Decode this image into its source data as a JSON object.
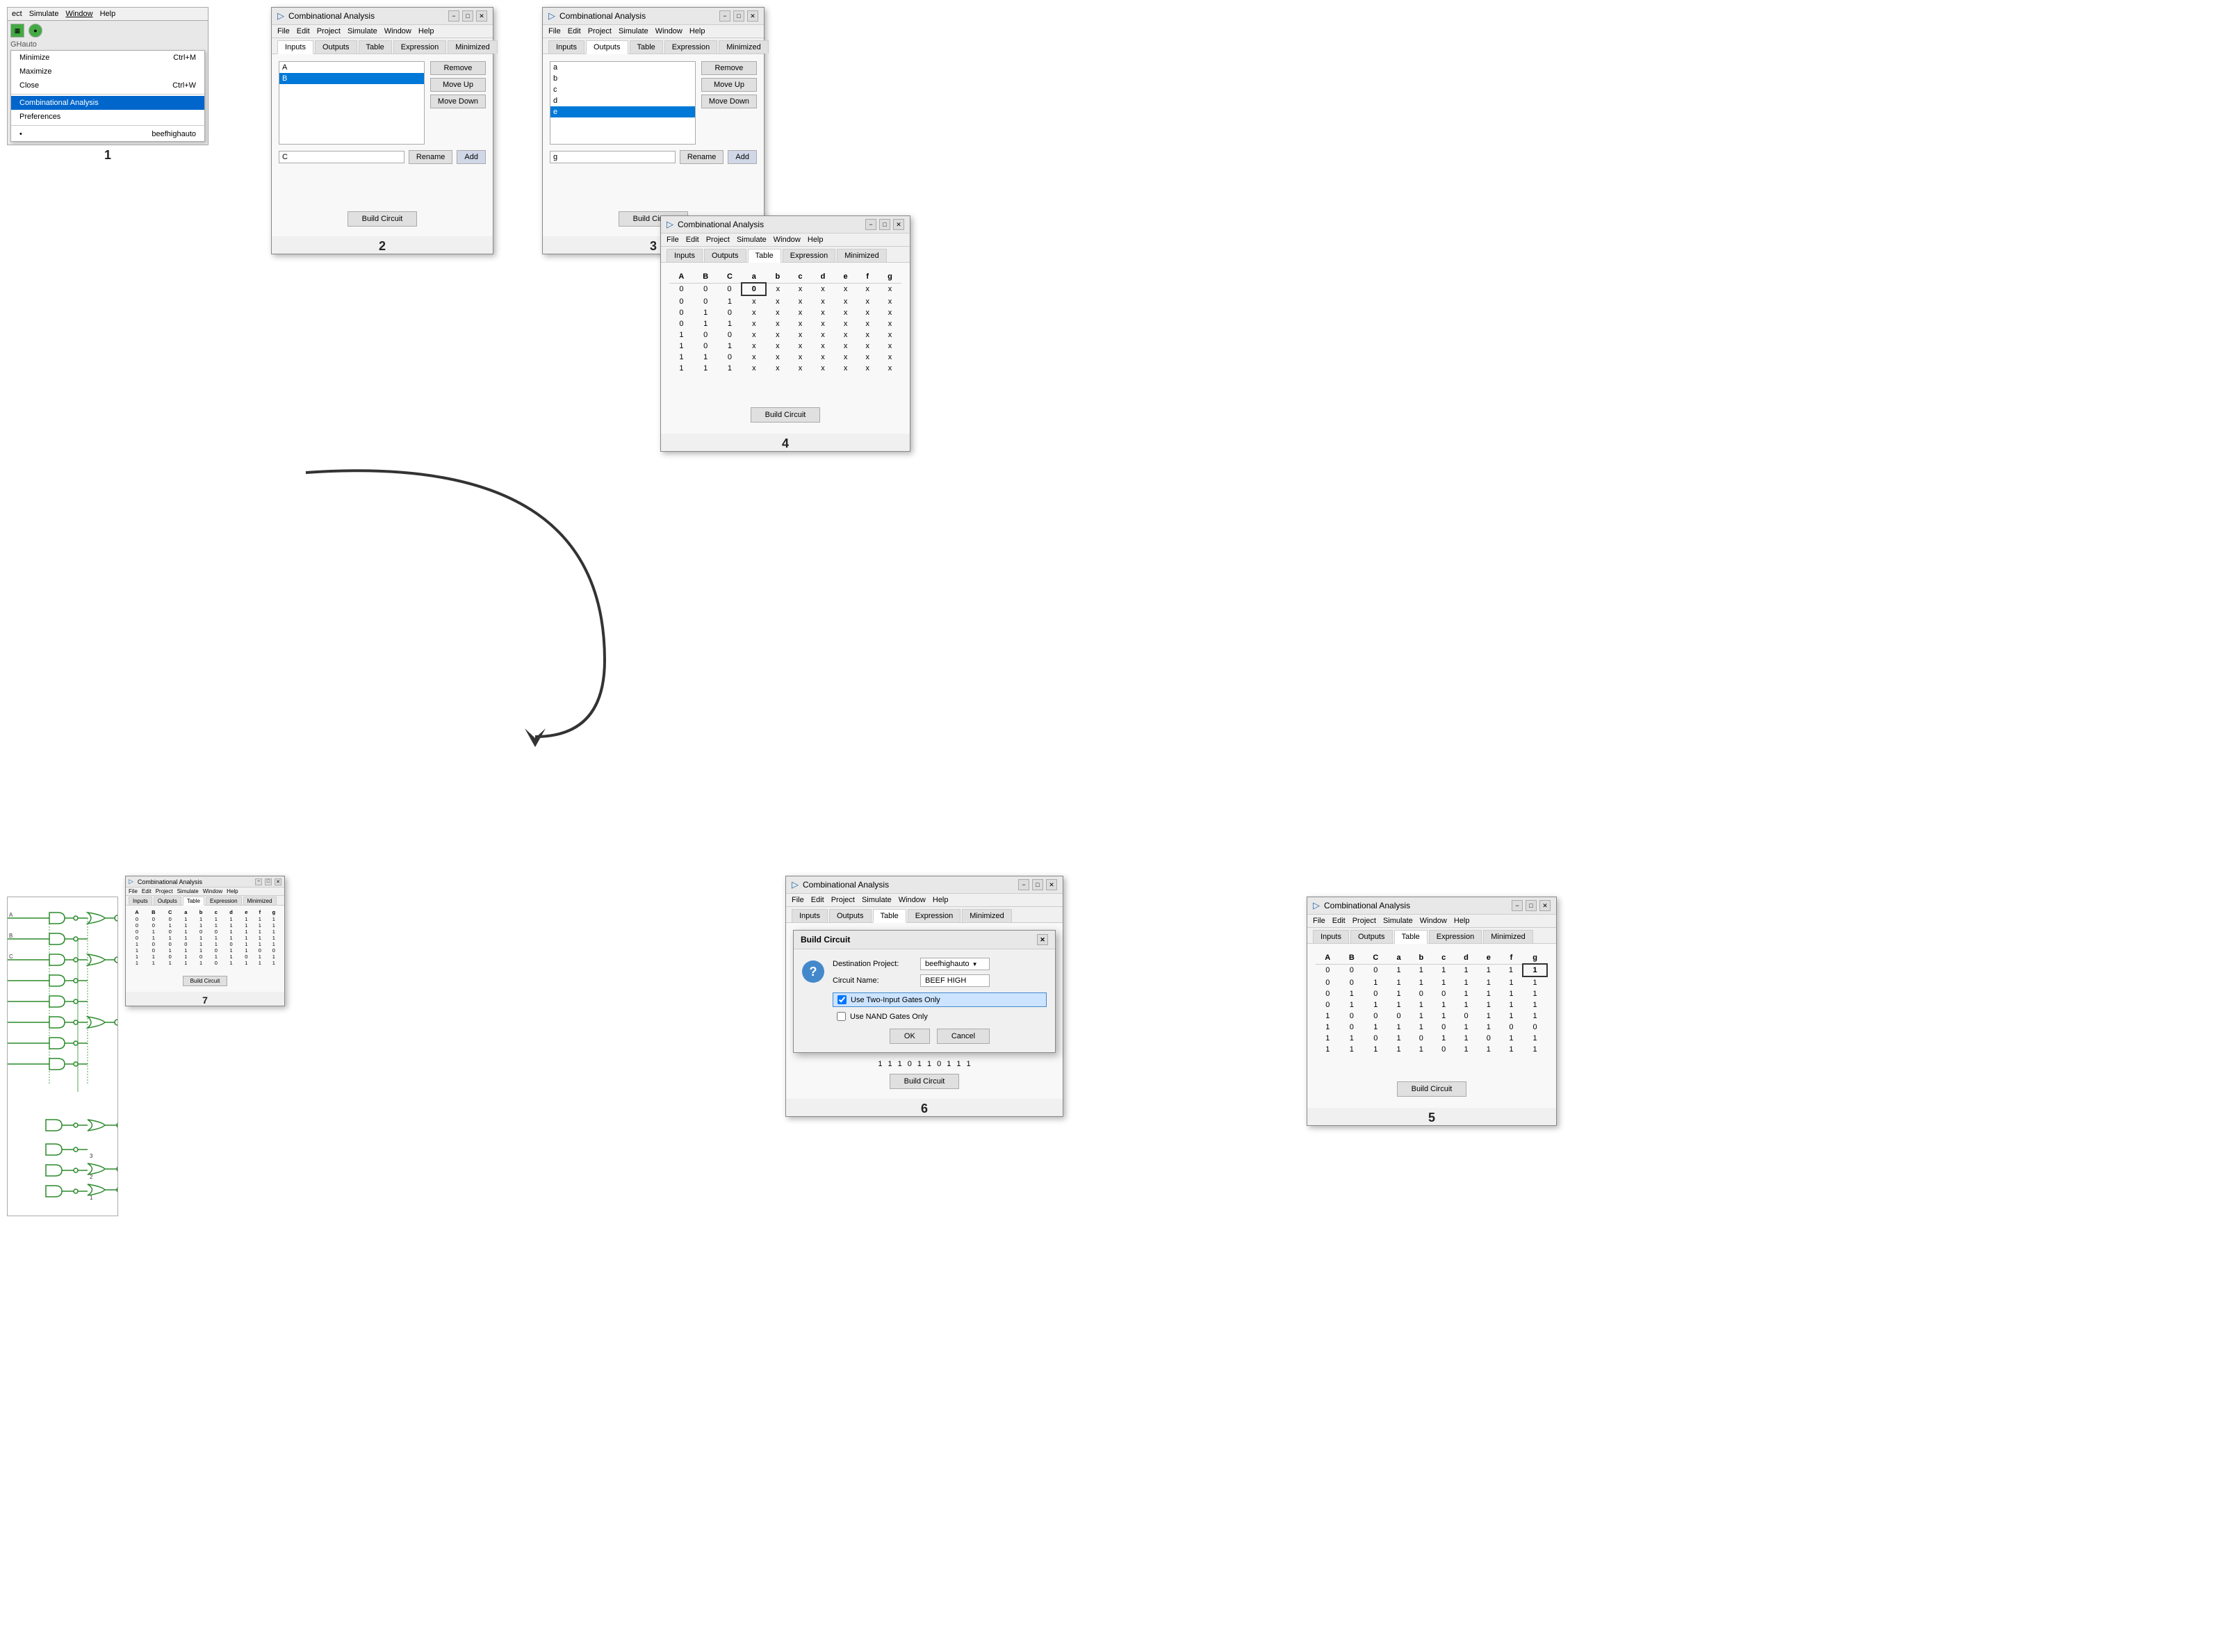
{
  "panels": {
    "panel1": {
      "menubar": [
        "ect",
        "Simulate",
        "Window",
        "Help"
      ],
      "dropdown": {
        "items": [
          {
            "label": "Minimize",
            "shortcut": "Ctrl+M",
            "type": "normal"
          },
          {
            "label": "Maximize",
            "shortcut": "",
            "type": "normal"
          },
          {
            "label": "Close",
            "shortcut": "Ctrl+W",
            "type": "normal"
          },
          {
            "label": "separator",
            "type": "separator"
          },
          {
            "label": "Combinational Analysis",
            "shortcut": "",
            "type": "highlighted"
          },
          {
            "label": "Preferences",
            "shortcut": "",
            "type": "normal"
          },
          {
            "label": "separator",
            "type": "separator"
          },
          {
            "label": "beefhighauto",
            "shortcut": "",
            "type": "bullet"
          }
        ]
      },
      "number": "1"
    },
    "panel2": {
      "title": "Combinational Analysis",
      "tabs": [
        "Inputs",
        "Outputs",
        "Table",
        "Expression",
        "Minimized"
      ],
      "active_tab": "Inputs",
      "list_items": [
        "A",
        "B"
      ],
      "selected_item": "B",
      "input_value": "C",
      "buttons": [
        "Remove",
        "Move Up",
        "Move Down"
      ],
      "bottom_buttons": [
        "Rename",
        "Add"
      ],
      "build_button": "Build Circuit",
      "number": "2"
    },
    "panel3": {
      "title": "Combinational Analysis",
      "tabs": [
        "Inputs",
        "Outputs",
        "Table",
        "Expression",
        "Minimized"
      ],
      "active_tab": "Outputs",
      "list_items": [
        "a",
        "b",
        "c",
        "d",
        "e"
      ],
      "selected_item": "e",
      "input_value": "g",
      "buttons": [
        "Remove",
        "Move Up",
        "Move Down"
      ],
      "bottom_buttons": [
        "Rename",
        "Add"
      ],
      "build_button": "Build Circuit",
      "number": "3"
    },
    "panel4": {
      "title": "Combinational Analysis",
      "tabs": [
        "Inputs",
        "Outputs",
        "Table",
        "Expression",
        "Minimized"
      ],
      "active_tab": "Table",
      "col_headers": [
        "A",
        "B",
        "C",
        "a",
        "b",
        "c",
        "d",
        "e",
        "f",
        "g"
      ],
      "rows": [
        [
          "0",
          "0",
          "0",
          "0",
          "x",
          "x",
          "x",
          "x",
          "x",
          "x"
        ],
        [
          "0",
          "0",
          "1",
          "x",
          "x",
          "x",
          "x",
          "x",
          "x",
          "x"
        ],
        [
          "0",
          "1",
          "0",
          "x",
          "x",
          "x",
          "x",
          "x",
          "x",
          "x"
        ],
        [
          "0",
          "1",
          "1",
          "x",
          "x",
          "x",
          "x",
          "x",
          "x",
          "x"
        ],
        [
          "1",
          "0",
          "0",
          "x",
          "x",
          "x",
          "x",
          "x",
          "x",
          "x"
        ],
        [
          "1",
          "0",
          "1",
          "x",
          "x",
          "x",
          "x",
          "x",
          "x",
          "x"
        ],
        [
          "1",
          "1",
          "0",
          "x",
          "x",
          "x",
          "x",
          "x",
          "x",
          "x"
        ],
        [
          "1",
          "1",
          "1",
          "x",
          "x",
          "x",
          "x",
          "x",
          "x",
          "x"
        ]
      ],
      "highlighted_cell": {
        "row": 0,
        "col": 3
      },
      "build_button": "Build Circuit",
      "number": "4"
    },
    "panel5": {
      "title": "Combinational Analysis",
      "tabs": [
        "Inputs",
        "Outputs",
        "Table",
        "Expression",
        "Minimized"
      ],
      "active_tab": "Table",
      "col_headers": [
        "A",
        "B",
        "C",
        "a",
        "b",
        "c",
        "d",
        "e",
        "f",
        "g"
      ],
      "rows": [
        [
          "0",
          "0",
          "0",
          "1",
          "1",
          "1",
          "1",
          "1",
          "1",
          "1"
        ],
        [
          "0",
          "0",
          "1",
          "1",
          "1",
          "1",
          "1",
          "1",
          "1",
          "1"
        ],
        [
          "0",
          "1",
          "0",
          "1",
          "0",
          "0",
          "1",
          "1",
          "1",
          "1"
        ],
        [
          "0",
          "1",
          "1",
          "1",
          "1",
          "1",
          "1",
          "1",
          "1",
          "1"
        ],
        [
          "1",
          "0",
          "0",
          "0",
          "1",
          "1",
          "0",
          "1",
          "1",
          "1"
        ],
        [
          "1",
          "0",
          "1",
          "1",
          "1",
          "0",
          "1",
          "1",
          "0",
          "0"
        ],
        [
          "1",
          "1",
          "0",
          "1",
          "0",
          "1",
          "1",
          "0",
          "1",
          "1"
        ],
        [
          "1",
          "1",
          "1",
          "1",
          "1",
          "0",
          "1",
          "1",
          "1",
          "1"
        ]
      ],
      "highlighted_cell": {
        "row": 0,
        "col": 9
      },
      "build_button": "Build Circuit",
      "number": "5"
    },
    "panel6": {
      "title_ca": "Combinational Analysis",
      "menubar": [
        "File",
        "Edit",
        "Project",
        "Simulate",
        "Window",
        "Help"
      ],
      "tabs": [
        "Inputs",
        "Outputs",
        "Table",
        "Expression",
        "Minimized"
      ],
      "dialog_title": "Build Circuit",
      "destination_label": "Destination Project:",
      "destination_value": "beefhighauto",
      "circuit_name_label": "Circuit Name:",
      "circuit_name_value": "BEEF HIGH",
      "checkbox1_label": "Use Two-Input Gates Only",
      "checkbox1_checked": true,
      "checkbox1_highlighted": true,
      "checkbox2_label": "Use NAND Gates Only",
      "checkbox2_checked": false,
      "ok_label": "OK",
      "cancel_label": "Cancel",
      "bottom_row": [
        "1",
        "1",
        "1",
        "0",
        "1",
        "1",
        "0",
        "1",
        "1",
        "1"
      ],
      "build_button": "Build Circuit",
      "number": "6"
    },
    "panel7": {
      "number": "7",
      "ca_title": "Combinational Analysis",
      "ca_tabs": [
        "Inputs",
        "Outputs",
        "Table",
        "Expression",
        "Minimized"
      ],
      "ca_col_headers": [
        "A",
        "B",
        "C",
        "a",
        "b",
        "c",
        "d",
        "e",
        "f",
        "g"
      ],
      "ca_rows": [
        [
          "0",
          "0",
          "0",
          "1",
          "1",
          "1",
          "1",
          "1",
          "1",
          "1"
        ],
        [
          "0",
          "0",
          "1",
          "1",
          "1",
          "1",
          "1",
          "1",
          "1",
          "1"
        ],
        [
          "0",
          "1",
          "0",
          "1",
          "0",
          "0",
          "1",
          "1",
          "1",
          "1"
        ],
        [
          "0",
          "1",
          "1",
          "1",
          "1",
          "1",
          "1",
          "1",
          "1",
          "1"
        ],
        [
          "1",
          "0",
          "0",
          "0",
          "1",
          "1",
          "0",
          "1",
          "1",
          "1"
        ],
        [
          "1",
          "0",
          "1",
          "1",
          "1",
          "0",
          "1",
          "1",
          "0",
          "0"
        ],
        [
          "1",
          "1",
          "0",
          "1",
          "0",
          "1",
          "1",
          "0",
          "1",
          "1"
        ],
        [
          "1",
          "1",
          "1",
          "1",
          "1",
          "0",
          "1",
          "1",
          "1",
          "1"
        ]
      ],
      "build_button": "Build Circuit"
    }
  },
  "menubar_items": {
    "file": "File",
    "edit": "Edit",
    "project": "Project",
    "simulate": "Simulate",
    "window": "Window",
    "help": "Help"
  },
  "window_controls": {
    "minimize": "−",
    "maximize": "□",
    "close": "✕"
  },
  "title_icon": "▷"
}
